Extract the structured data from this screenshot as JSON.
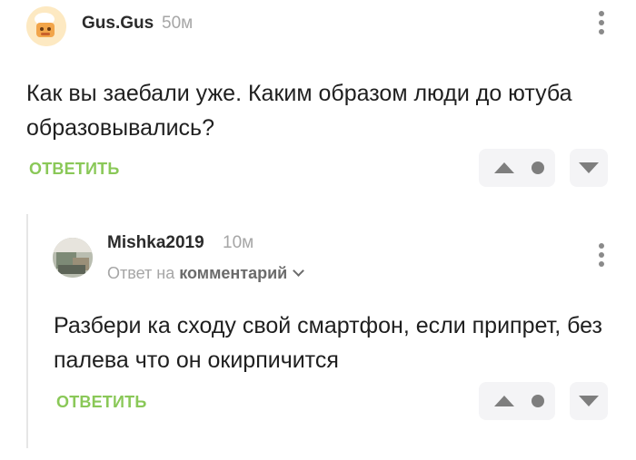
{
  "comments": [
    {
      "username": "Gus.Gus",
      "time": "50м",
      "text": "Как вы заебали уже. Каким образом люди до ютуба образовывались?",
      "reply_label": "ОТВЕТИТЬ",
      "avatar_icon": "cartoon-avatar-icon"
    },
    {
      "username": "Mishka2019",
      "time": "10м",
      "reply_to_prefix": "Ответ на",
      "reply_to_target": "комментарий",
      "text": "Разбери ка сходу свой смартфон, если припрет, без палева что он окирпичится",
      "reply_label": "ОТВЕТИТЬ",
      "avatar_icon": "photo-avatar-icon"
    }
  ],
  "colors": {
    "accent_green": "#8ac858",
    "muted_gray": "#a6a6a6",
    "vote_bg": "#f4f4f6"
  },
  "icons": {
    "menu": "kebab-menu-icon",
    "upvote": "upvote-triangle-icon",
    "rating": "rating-dot-icon",
    "downvote": "downvote-triangle-icon",
    "expand": "chevron-down-icon"
  }
}
